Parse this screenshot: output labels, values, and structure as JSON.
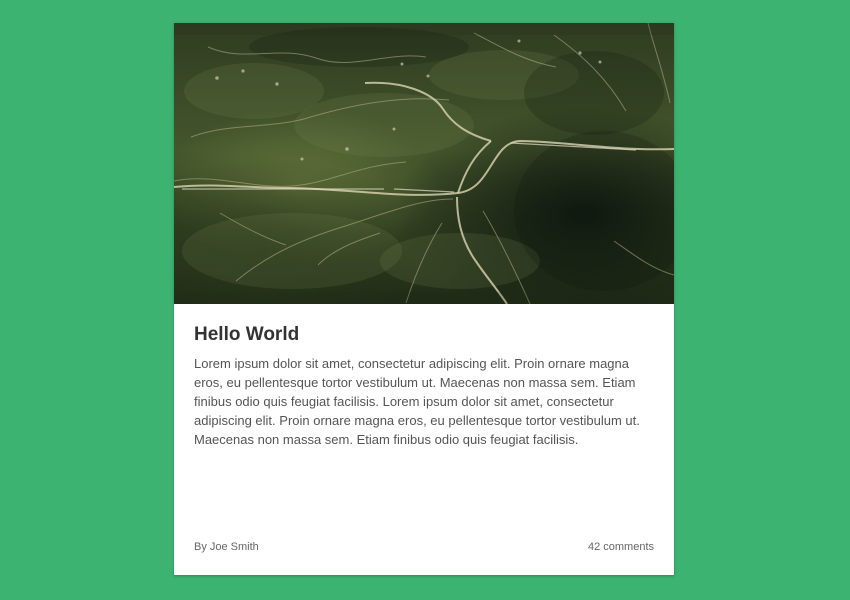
{
  "page": {
    "background_color": "#3cb371"
  },
  "card": {
    "title": "Hello World",
    "body": "Lorem ipsum dolor sit amet, consectetur adipiscing elit. Proin ornare magna eros, eu pellentesque tortor vestibulum ut. Maecenas non massa sem. Etiam finibus odio quis feugiat facilisis. Lorem ipsum dolor sit amet, consectetur adipiscing elit. Proin ornare magna eros, eu pellentesque tortor vestibulum ut. Maecenas non massa sem. Etiam finibus odio quis feugiat facilisis.",
    "author": "By Joe Smith",
    "comments": "42 comments",
    "image_icon": "aerial-landscape-photo"
  }
}
